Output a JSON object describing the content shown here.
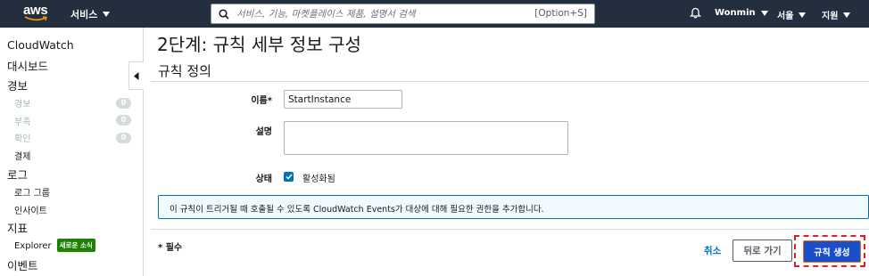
{
  "topnav": {
    "logo_text": "aws",
    "services_label": "서비스",
    "search_placeholder": "서비스, 기능, 마켓플레이스 제품, 설명서 검색",
    "search_shortcut": "[Option+S]",
    "user": "Wonmin",
    "region": "서울",
    "support": "지원"
  },
  "sidebar": {
    "title": "CloudWatch",
    "dashboard": "대시보드",
    "alarms": "경보",
    "alarm_items": [
      {
        "label": "경보",
        "count": "0"
      },
      {
        "label": "부족",
        "count": "0"
      },
      {
        "label": "확인",
        "count": "0"
      }
    ],
    "billing": "결제",
    "logs": "로그",
    "log_groups": "로그 그룹",
    "insights": "인사이트",
    "metrics": "지표",
    "explorer": "Explorer",
    "new_badge": "새로운 소식",
    "events": "이벤트"
  },
  "main": {
    "page_title": "2단계: 규칙 세부 정보 구성",
    "section_title": "규칙 정의",
    "name_label": "이름*",
    "name_value": "StartInstance",
    "desc_label": "설명",
    "desc_value": "",
    "state_label": "상태",
    "state_checked": true,
    "state_text": "활성화됨",
    "info_text": "이 규칙이 트리거될 때 호출될 수 있도록 CloudWatch Events가 대상에 대해 필요한 권한을 추가합니다.",
    "required_note": "* 필수",
    "cancel_label": "취소",
    "back_label": "뒤로 가기",
    "create_label": "규칙 생성"
  },
  "colors": {
    "nav_bg": "#232f3e",
    "accent_blue": "#0073bb",
    "primary_button": "#1a4fc9",
    "highlight": "#e02020",
    "new_badge": "#1d8102"
  }
}
